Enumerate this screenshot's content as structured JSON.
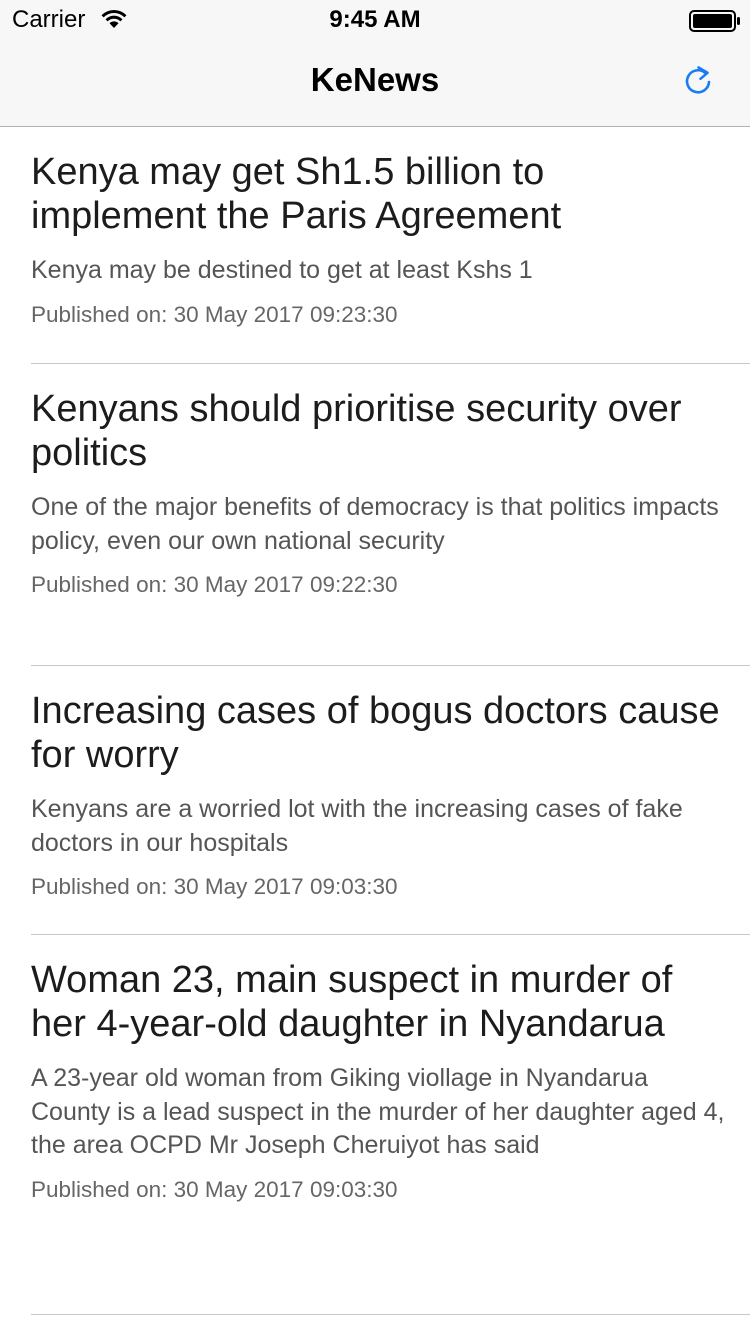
{
  "status_bar": {
    "carrier": "Carrier",
    "time": "9:45 AM",
    "wifi_icon": "wifi-icon",
    "battery_icon": "battery-icon"
  },
  "nav": {
    "title": "KeNews",
    "refresh_icon": "refresh-icon",
    "accent_color": "#1a7cf4"
  },
  "articles": [
    {
      "title": "Kenya may get Sh1.5 billion to implement the Paris Agreement",
      "summary": "Kenya may be destined to get at least Kshs 1",
      "published": "Published on: 30 May 2017 09:23:30"
    },
    {
      "title": "Kenyans should prioritise security over politics",
      "summary": "One of the major benefits of democracy is that politics impacts policy, even our own national security",
      "published": "Published on: 30 May 2017 09:22:30"
    },
    {
      "title": "Increasing cases of bogus doctors cause for worry",
      "summary": "Kenyans are a worried lot with the increasing cases of fake doctors in our hospitals",
      "published": "Published on: 30 May 2017 09:03:30"
    },
    {
      "title": "Woman 23, main suspect in murder of her 4-year-old daughter in Nyandarua",
      "summary": "A 23-year old woman from Giking viollage in Nyandarua County is a lead suspect in the murder of her daughter aged 4, the area OCPD Mr Joseph Cheruiyot has said",
      "published": "Published on: 30 May 2017 09:03:30"
    }
  ]
}
